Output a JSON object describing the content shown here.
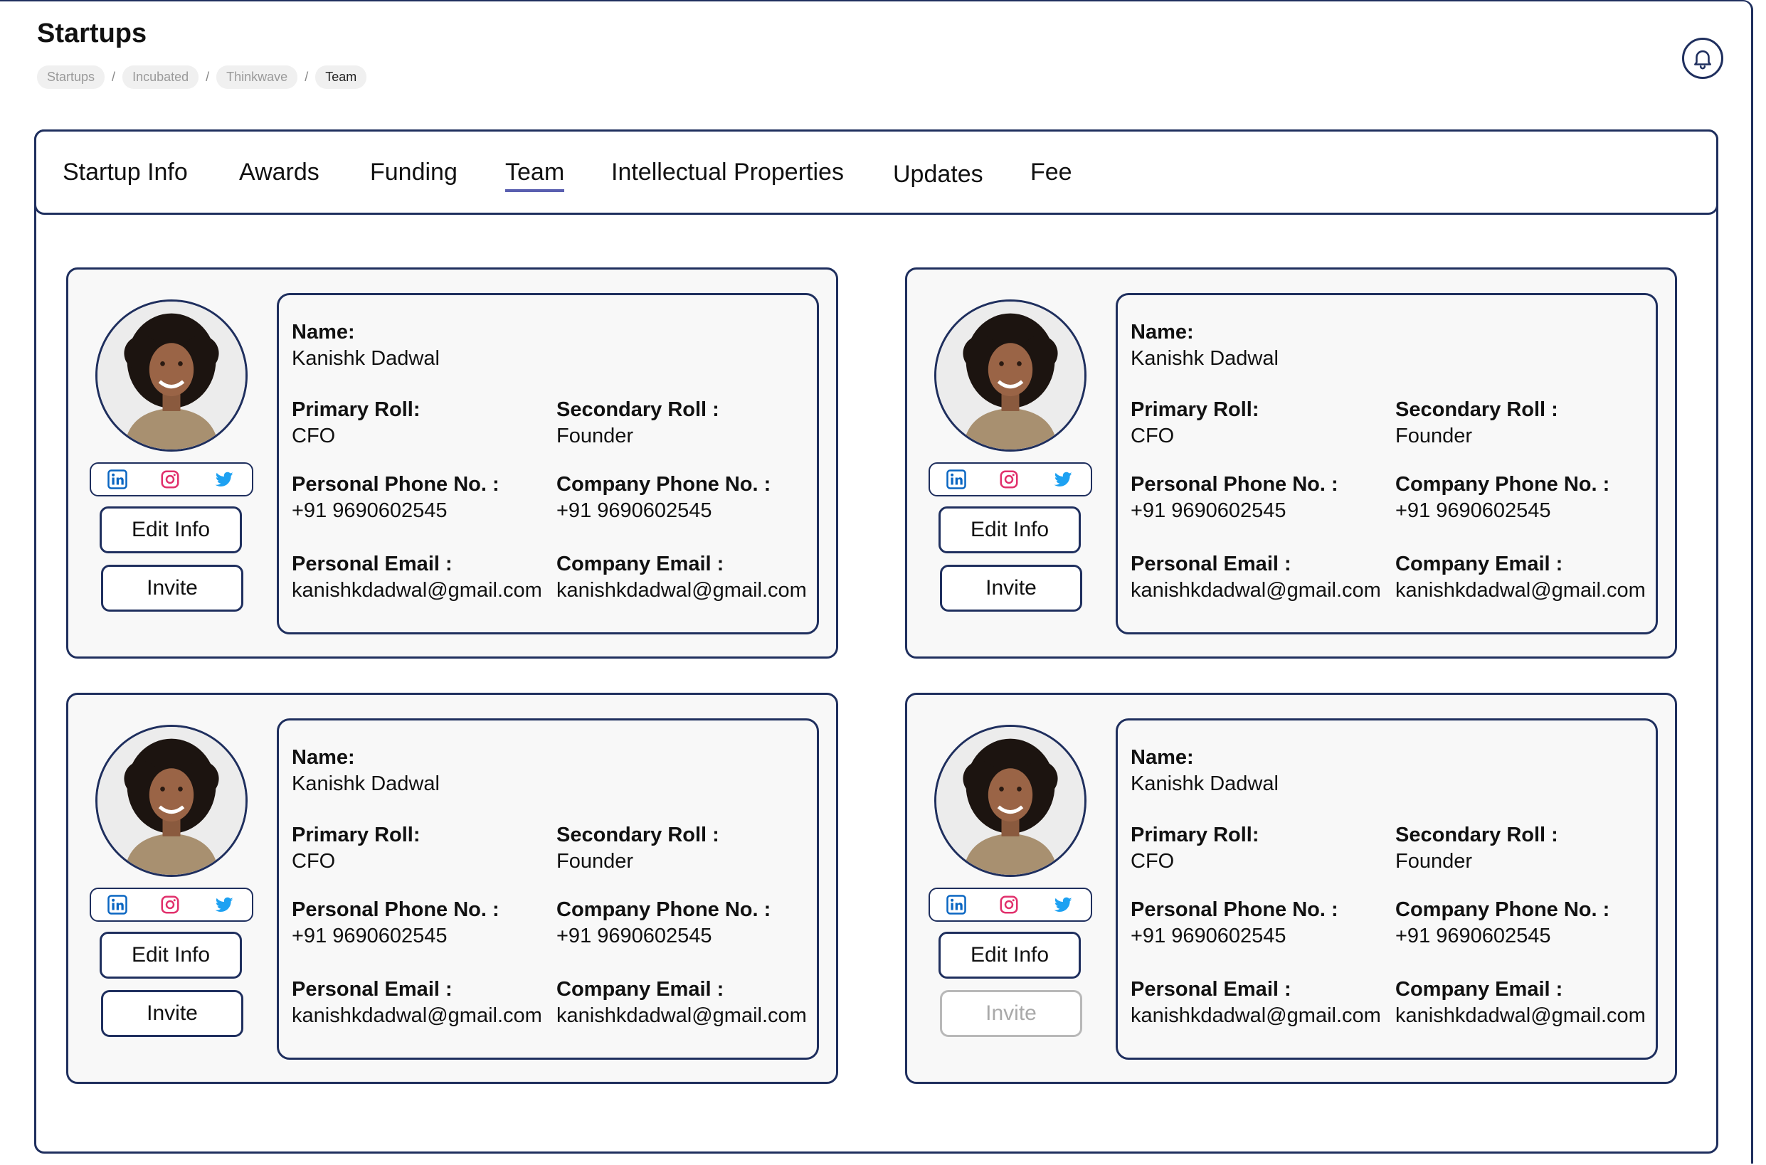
{
  "header": {
    "title": "Startups",
    "breadcrumb": [
      "Startups",
      "Incubated",
      "Thinkwave",
      "Team"
    ],
    "separator": "/"
  },
  "tabs": [
    "Startup Info",
    "Awards",
    "Funding",
    "Team",
    "Intellectual Properties",
    "Updates",
    "Fee"
  ],
  "active_tab": "Team",
  "labels": {
    "name": "Name:",
    "primary_roll": "Primary Roll:",
    "secondary_roll": "Secondary Roll :",
    "personal_phone": "Personal Phone No. :",
    "company_phone": "Company Phone No. :",
    "personal_email": "Personal Email :",
    "company_email": "Company Email :",
    "edit_button": "Edit Info",
    "invite_button": "Invite"
  },
  "members": [
    {
      "name": "Kanishk Dadwal",
      "primary_roll": "CFO",
      "secondary_roll": "Founder",
      "personal_phone": "+91 9690602545",
      "company_phone": "+91 9690602545",
      "personal_email": "kanishkdadwal@gmail.com",
      "company_email": "kanishkdadwal@gmail.com",
      "invite_enabled": true
    },
    {
      "name": "Kanishk Dadwal",
      "primary_roll": "CFO",
      "secondary_roll": "Founder",
      "personal_phone": "+91 9690602545",
      "company_phone": "+91 9690602545",
      "personal_email": "kanishkdadwal@gmail.com",
      "company_email": "kanishkdadwal@gmail.com",
      "invite_enabled": true
    },
    {
      "name": "Kanishk Dadwal",
      "primary_roll": "CFO",
      "secondary_roll": "Founder",
      "personal_phone": "+91 9690602545",
      "company_phone": "+91 9690602545",
      "personal_email": "kanishkdadwal@gmail.com",
      "company_email": "kanishkdadwal@gmail.com",
      "invite_enabled": true
    },
    {
      "name": "Kanishk Dadwal",
      "primary_roll": "CFO",
      "secondary_roll": "Founder",
      "personal_phone": "+91 9690602545",
      "company_phone": "+91 9690602545",
      "personal_email": "kanishkdadwal@gmail.com",
      "company_email": "kanishkdadwal@gmail.com",
      "invite_enabled": false
    }
  ],
  "social_icons": [
    "linkedin-icon",
    "instagram-icon",
    "twitter-icon"
  ],
  "colors": {
    "border": "#1f2f5e",
    "card_bg": "#f8f8f8",
    "tab_underline": "#5a5fb0",
    "linkedin": "#0a66c2",
    "instagram": "#e1306c",
    "twitter": "#1da1f2",
    "disabled": "#b8b8b8"
  }
}
